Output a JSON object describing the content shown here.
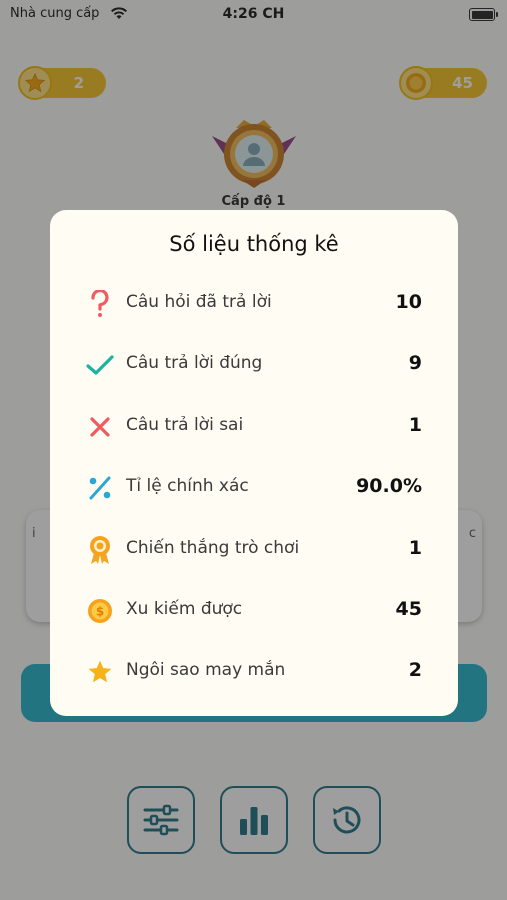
{
  "status_bar": {
    "carrier": "Nhà cung cấp",
    "time": "4:26 CH"
  },
  "header": {
    "stars": "2",
    "coins": "45",
    "level": "Cấp độ 1"
  },
  "background": {
    "card_left_edge": "i",
    "card_left_edge2": "b",
    "card_right_edge": "c"
  },
  "colors": {
    "accent": "#1eb5c9",
    "gold": "#f6c21c",
    "dark_teal": "#1a6e80",
    "overlay": "#282828"
  },
  "stats_modal": {
    "title": "Số liệu thống kê",
    "rows": [
      {
        "icon": "question-icon",
        "label": "Câu hỏi đã trả lời",
        "value": "10"
      },
      {
        "icon": "checkmark-icon",
        "label": "Câu trả lời đúng",
        "value": "9"
      },
      {
        "icon": "cross-icon",
        "label": "Câu trả lời sai",
        "value": "1"
      },
      {
        "icon": "percent-icon",
        "label": "Tỉ lệ chính xác",
        "value": "90.0%"
      },
      {
        "icon": "medal-icon",
        "label": "Chiến thắng trò chơi",
        "value": "1"
      },
      {
        "icon": "coin-icon",
        "label": "Xu kiếm được",
        "value": "45"
      },
      {
        "icon": "star-icon",
        "label": "Ngôi sao may mắn",
        "value": "2"
      }
    ]
  },
  "bottom_bar": {
    "buttons": [
      "settings-icon",
      "bar-chart-icon",
      "history-icon"
    ]
  }
}
